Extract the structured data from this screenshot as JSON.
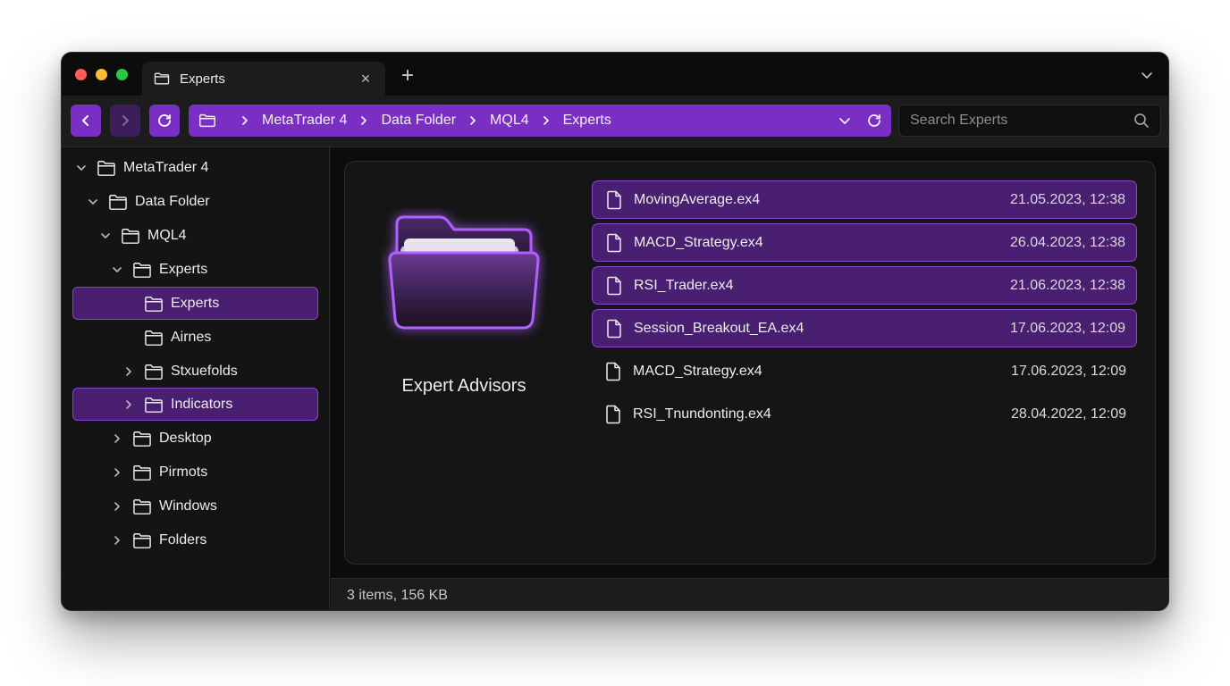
{
  "window": {
    "tab": {
      "title": "Experts",
      "close_glyph": "×"
    },
    "new_tab_glyph": "+"
  },
  "toolbar": {
    "breadcrumbs": [
      "MetaTrader 4",
      "Data Folder",
      "MQL4",
      "Experts"
    ],
    "search_placeholder": "Search Experts"
  },
  "sidebar": {
    "items": [
      {
        "label": "MetaTrader 4",
        "expanded": true
      },
      {
        "label": "Data Folder",
        "expanded": true
      },
      {
        "label": "MQL4",
        "expanded": true
      },
      {
        "label": "Experts",
        "expanded": true
      },
      {
        "label": "Experts",
        "selected": true
      },
      {
        "label": "Airnes"
      },
      {
        "label": "Stxuefolds",
        "expanded": false
      },
      {
        "label": "Indicators",
        "expanded": false,
        "selected": true
      },
      {
        "label": "Desktop",
        "expanded": false
      },
      {
        "label": "Pirmots",
        "expanded": false
      },
      {
        "label": "Windows",
        "expanded": false
      },
      {
        "label": "Folders",
        "expanded": false
      }
    ]
  },
  "main": {
    "folder_label": "Expert Advisors",
    "files": [
      {
        "name": "MovingAverage.ex4",
        "date": "21.05.2023, 12:38",
        "highlighted": true
      },
      {
        "name": "MACD_Strategy.ex4",
        "date": "26.04.2023, 12:38",
        "highlighted": true
      },
      {
        "name": "RSI_Trader.ex4",
        "date": "21.06.2023, 12:38",
        "highlighted": true
      },
      {
        "name": "Session_Breakout_EA.ex4",
        "date": "17.06.2023, 12:09",
        "highlighted": true
      },
      {
        "name": "MACD_Strategy.ex4",
        "date": "17.06.2023, 12:09",
        "highlighted": false
      },
      {
        "name": "RSI_Tnundonting.ex4",
        "date": "28.04.2022, 12:09",
        "highlighted": false
      }
    ]
  },
  "status": {
    "text": "3 items, 156 KB"
  },
  "colors": {
    "accent": "#7a2fc4",
    "selection": "#4a1f71",
    "selection_border": "#8a45d1"
  }
}
